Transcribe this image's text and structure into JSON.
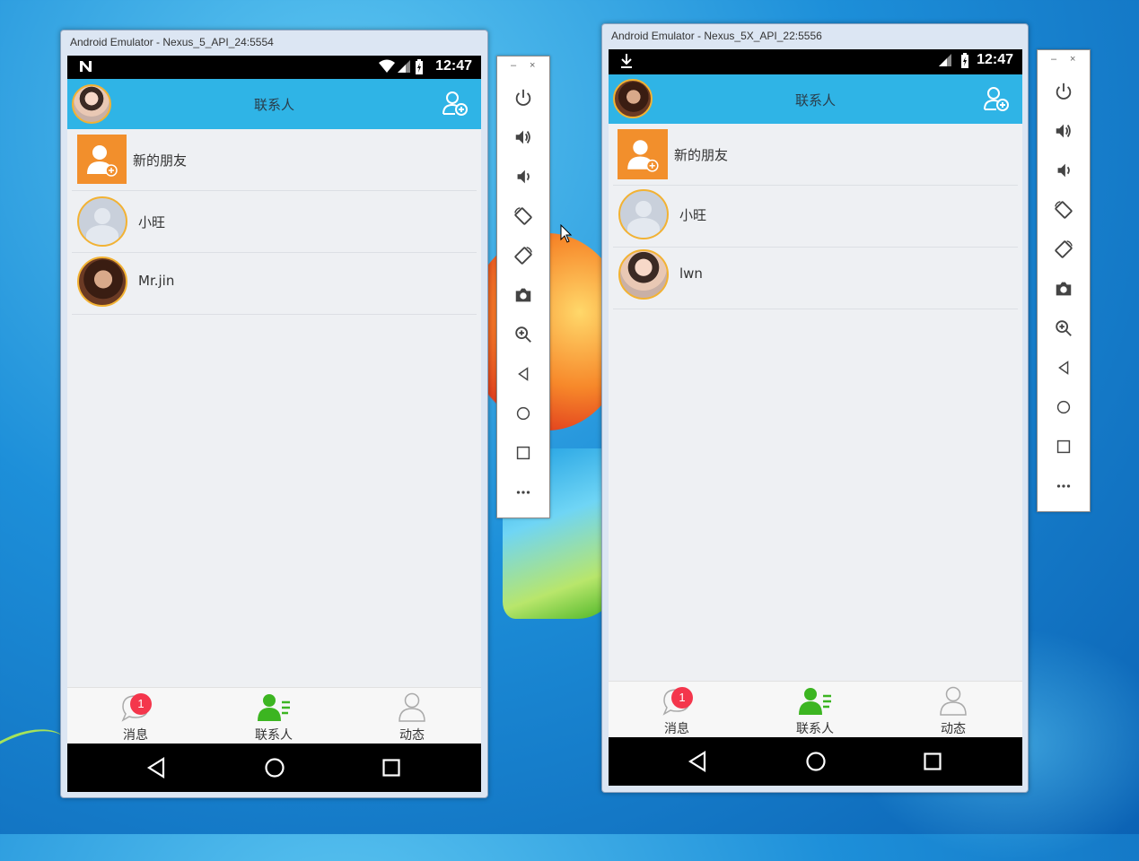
{
  "emulators": [
    {
      "window_title": "Android Emulator - Nexus_5_API_24:5554",
      "status_time": "12:47",
      "app_title": "联系人",
      "contacts": [
        "新的朋友",
        "小旺",
        "Mr.jin"
      ],
      "tabs": [
        {
          "label": "消息",
          "badge": "1"
        },
        {
          "label": "联系人"
        },
        {
          "label": "动态"
        }
      ]
    },
    {
      "window_title": "Android Emulator - Nexus_5X_API_22:5556",
      "status_time": "12:47",
      "app_title": "联系人",
      "contacts": [
        "新的朋友",
        "小旺",
        "lwn"
      ],
      "tabs": [
        {
          "label": "消息",
          "badge": "1"
        },
        {
          "label": "联系人"
        },
        {
          "label": "动态"
        }
      ]
    }
  ],
  "toolbar": {
    "minimize": "–",
    "close": "×",
    "buttons": [
      "power-icon",
      "volume-up-icon",
      "volume-down-icon",
      "rotate-left-icon",
      "rotate-right-icon",
      "camera-icon",
      "zoom-icon",
      "back-icon",
      "home-icon",
      "overview-icon",
      "more-icon"
    ]
  },
  "colors": {
    "appbar": "#2fb4e6",
    "accent_orange": "#f28f2c",
    "badge": "#f4364c",
    "active_tab": "#3cb521"
  }
}
